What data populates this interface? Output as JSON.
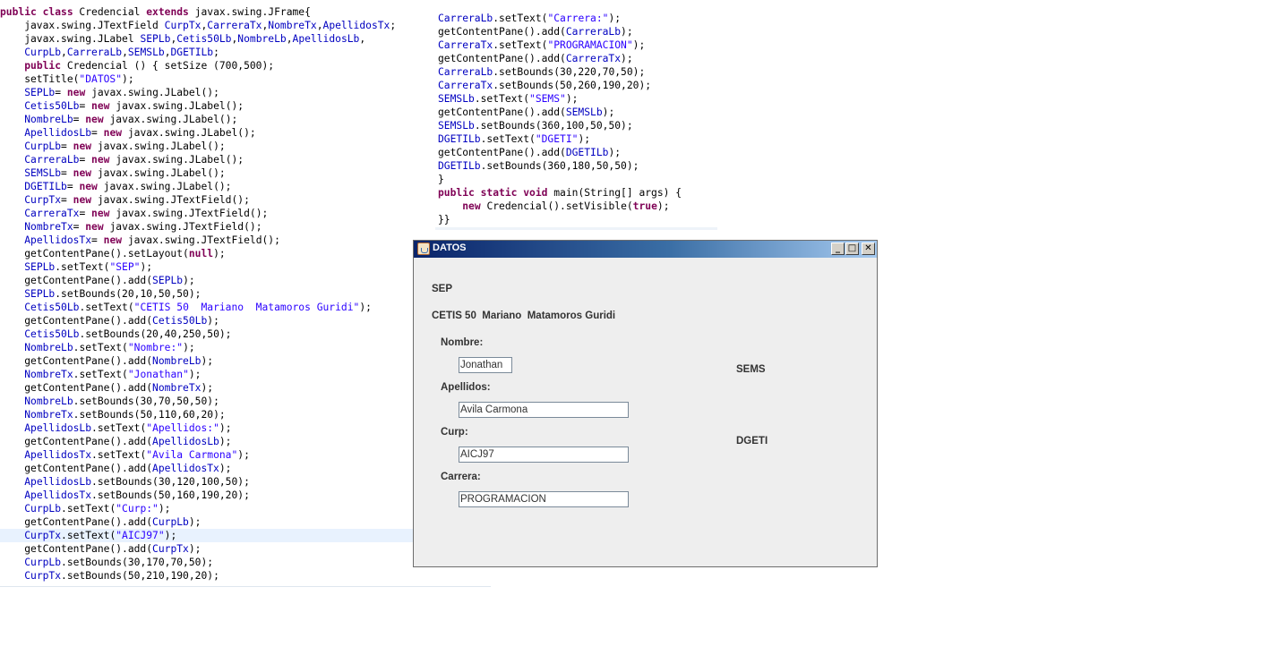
{
  "editor_left": {
    "lines": [
      [
        [
          "kw",
          "public class "
        ],
        [
          "",
          "Credencial "
        ],
        [
          "kw",
          "extends "
        ],
        [
          "",
          "javax.swing.JFrame{"
        ]
      ],
      [
        [
          "",
          "    javax.swing.JTextField "
        ],
        [
          "fld",
          "CurpTx"
        ],
        [
          "",
          ","
        ],
        [
          "fld",
          "CarreraTx"
        ],
        [
          "",
          ","
        ],
        [
          "fld",
          "NombreTx"
        ],
        [
          "",
          ","
        ],
        [
          "fld",
          "ApellidosTx"
        ],
        [
          "",
          ";"
        ]
      ],
      [
        [
          "",
          "    javax.swing.JLabel "
        ],
        [
          "fld",
          "SEPLb"
        ],
        [
          "",
          ","
        ],
        [
          "fld",
          "Cetis50Lb"
        ],
        [
          "",
          ","
        ],
        [
          "fld",
          "NombreLb"
        ],
        [
          "",
          ","
        ],
        [
          "fld",
          "ApellidosLb"
        ],
        [
          "",
          ","
        ]
      ],
      [
        [
          "",
          "    "
        ],
        [
          "fld",
          "CurpLb"
        ],
        [
          "",
          ","
        ],
        [
          "fld",
          "CarreraLb"
        ],
        [
          "",
          ","
        ],
        [
          "fld",
          "SEMSLb"
        ],
        [
          "",
          ","
        ],
        [
          "fld",
          "DGETILb"
        ],
        [
          "",
          ";"
        ]
      ],
      [
        [
          "",
          "    "
        ],
        [
          "kw",
          "public "
        ],
        [
          "",
          "Credencial () { setSize (700,500);"
        ]
      ],
      [
        [
          "",
          "    setTitle("
        ],
        [
          "str",
          "\"DATOS\""
        ],
        [
          "",
          ");"
        ]
      ],
      [
        [
          "",
          "    "
        ],
        [
          "fld",
          "SEPLb"
        ],
        [
          "",
          "= "
        ],
        [
          "kw",
          "new "
        ],
        [
          "",
          "javax.swing.JLabel();"
        ]
      ],
      [
        [
          "",
          "    "
        ],
        [
          "fld",
          "Cetis50Lb"
        ],
        [
          "",
          "= "
        ],
        [
          "kw",
          "new "
        ],
        [
          "",
          "javax.swing.JLabel();"
        ]
      ],
      [
        [
          "",
          "    "
        ],
        [
          "fld",
          "NombreLb"
        ],
        [
          "",
          "= "
        ],
        [
          "kw",
          "new "
        ],
        [
          "",
          "javax.swing.JLabel();"
        ]
      ],
      [
        [
          "",
          "    "
        ],
        [
          "fld",
          "ApellidosLb"
        ],
        [
          "",
          "= "
        ],
        [
          "kw",
          "new "
        ],
        [
          "",
          "javax.swing.JLabel();"
        ]
      ],
      [
        [
          "",
          "    "
        ],
        [
          "fld",
          "CurpLb"
        ],
        [
          "",
          "= "
        ],
        [
          "kw",
          "new "
        ],
        [
          "",
          "javax.swing.JLabel();"
        ]
      ],
      [
        [
          "",
          "    "
        ],
        [
          "fld",
          "CarreraLb"
        ],
        [
          "",
          "= "
        ],
        [
          "kw",
          "new "
        ],
        [
          "",
          "javax.swing.JLabel();"
        ]
      ],
      [
        [
          "",
          "    "
        ],
        [
          "fld",
          "SEMSLb"
        ],
        [
          "",
          "= "
        ],
        [
          "kw",
          "new "
        ],
        [
          "",
          "javax.swing.JLabel();"
        ]
      ],
      [
        [
          "",
          "    "
        ],
        [
          "fld",
          "DGETILb"
        ],
        [
          "",
          "= "
        ],
        [
          "kw",
          "new "
        ],
        [
          "",
          "javax.swing.JLabel();"
        ]
      ],
      [
        [
          "",
          "    "
        ],
        [
          "fld",
          "CurpTx"
        ],
        [
          "",
          "= "
        ],
        [
          "kw",
          "new "
        ],
        [
          "",
          "javax.swing.JTextField();"
        ]
      ],
      [
        [
          "",
          "    "
        ],
        [
          "fld",
          "CarreraTx"
        ],
        [
          "",
          "= "
        ],
        [
          "kw",
          "new "
        ],
        [
          "",
          "javax.swing.JTextField();"
        ]
      ],
      [
        [
          "",
          "    "
        ],
        [
          "fld",
          "NombreTx"
        ],
        [
          "",
          "= "
        ],
        [
          "kw",
          "new "
        ],
        [
          "",
          "javax.swing.JTextField();"
        ]
      ],
      [
        [
          "",
          "    "
        ],
        [
          "fld",
          "ApellidosTx"
        ],
        [
          "",
          "= "
        ],
        [
          "kw",
          "new "
        ],
        [
          "",
          "javax.swing.JTextField();"
        ]
      ],
      [
        [
          "",
          "    getContentPane().setLayout("
        ],
        [
          "kw",
          "null"
        ],
        [
          "",
          ");"
        ]
      ],
      [
        [
          "",
          "    "
        ],
        [
          "fld",
          "SEPLb"
        ],
        [
          "",
          ".setText("
        ],
        [
          "str",
          "\"SEP\""
        ],
        [
          "",
          ");"
        ]
      ],
      [
        [
          "",
          "    getContentPane().add("
        ],
        [
          "fld",
          "SEPLb"
        ],
        [
          "",
          ");"
        ]
      ],
      [
        [
          "",
          "    "
        ],
        [
          "fld",
          "SEPLb"
        ],
        [
          "",
          ".setBounds(20,10,50,50);"
        ]
      ],
      [
        [
          "",
          "    "
        ],
        [
          "fld",
          "Cetis50Lb"
        ],
        [
          "",
          ".setText("
        ],
        [
          "str",
          "\"CETIS 50  Mariano  Matamoros Guridi\""
        ],
        [
          "",
          ");"
        ]
      ],
      [
        [
          "",
          "    getContentPane().add("
        ],
        [
          "fld",
          "Cetis50Lb"
        ],
        [
          "",
          ");"
        ]
      ],
      [
        [
          "",
          "    "
        ],
        [
          "fld",
          "Cetis50Lb"
        ],
        [
          "",
          ".setBounds(20,40,250,50);"
        ]
      ],
      [
        [
          "",
          "    "
        ],
        [
          "fld",
          "NombreLb"
        ],
        [
          "",
          ".setText("
        ],
        [
          "str",
          "\"Nombre:\""
        ],
        [
          "",
          ");"
        ]
      ],
      [
        [
          "",
          "    getContentPane().add("
        ],
        [
          "fld",
          "NombreLb"
        ],
        [
          "",
          ");"
        ]
      ],
      [
        [
          "",
          "    "
        ],
        [
          "fld",
          "NombreTx"
        ],
        [
          "",
          ".setText("
        ],
        [
          "str",
          "\"Jonathan\""
        ],
        [
          "",
          ");"
        ]
      ],
      [
        [
          "",
          "    getContentPane().add("
        ],
        [
          "fld",
          "NombreTx"
        ],
        [
          "",
          ");"
        ]
      ],
      [
        [
          "",
          "    "
        ],
        [
          "fld",
          "NombreLb"
        ],
        [
          "",
          ".setBounds(30,70,50,50);"
        ]
      ],
      [
        [
          "",
          "    "
        ],
        [
          "fld",
          "NombreTx"
        ],
        [
          "",
          ".setBounds(50,110,60,20);"
        ]
      ],
      [
        [
          "",
          "    "
        ],
        [
          "fld",
          "ApellidosLb"
        ],
        [
          "",
          ".setText("
        ],
        [
          "str",
          "\"Apellidos:\""
        ],
        [
          "",
          ");"
        ]
      ],
      [
        [
          "",
          "    getContentPane().add("
        ],
        [
          "fld",
          "ApellidosLb"
        ],
        [
          "",
          ");"
        ]
      ],
      [
        [
          "",
          "    "
        ],
        [
          "fld",
          "ApellidosTx"
        ],
        [
          "",
          ".setText("
        ],
        [
          "str",
          "\"Avila Carmona\""
        ],
        [
          "",
          ");"
        ]
      ],
      [
        [
          "",
          "    getContentPane().add("
        ],
        [
          "fld",
          "ApellidosTx"
        ],
        [
          "",
          ");"
        ]
      ],
      [
        [
          "",
          "    "
        ],
        [
          "fld",
          "ApellidosLb"
        ],
        [
          "",
          ".setBounds(30,120,100,50);"
        ]
      ],
      [
        [
          "",
          "    "
        ],
        [
          "fld",
          "ApellidosTx"
        ],
        [
          "",
          ".setBounds(50,160,190,20);"
        ]
      ],
      [
        [
          "",
          "    "
        ],
        [
          "fld",
          "CurpLb"
        ],
        [
          "",
          ".setText("
        ],
        [
          "str",
          "\"Curp:\""
        ],
        [
          "",
          ");"
        ]
      ],
      [
        [
          "",
          "    getContentPane().add("
        ],
        [
          "fld",
          "CurpLb"
        ],
        [
          "",
          ");"
        ]
      ],
      [
        [
          "",
          "    "
        ],
        [
          "fld",
          "CurpTx"
        ],
        [
          "",
          ".setText("
        ],
        [
          "str",
          "\"AICJ97\""
        ],
        [
          "",
          ");"
        ]
      ],
      [
        [
          "",
          "    getContentPane().add("
        ],
        [
          "fld",
          "CurpTx"
        ],
        [
          "",
          ");"
        ]
      ],
      [
        [
          "",
          "    "
        ],
        [
          "fld",
          "CurpLb"
        ],
        [
          "",
          ".setBounds(30,170,70,50);"
        ]
      ],
      [
        [
          "",
          "    "
        ],
        [
          "fld",
          "CurpTx"
        ],
        [
          "",
          ".setBounds(50,210,190,20);"
        ]
      ]
    ],
    "highlight_line": 39
  },
  "editor_right": {
    "lines": [
      [
        [
          "fld",
          "CarreraLb"
        ],
        [
          "",
          ".setText("
        ],
        [
          "str",
          "\"Carrera:\""
        ],
        [
          "",
          ");"
        ]
      ],
      [
        [
          "",
          "getContentPane().add("
        ],
        [
          "fld",
          "CarreraLb"
        ],
        [
          "",
          ");"
        ]
      ],
      [
        [
          "fld",
          "CarreraTx"
        ],
        [
          "",
          ".setText("
        ],
        [
          "str",
          "\"PROGRAMACION\""
        ],
        [
          "",
          ");"
        ]
      ],
      [
        [
          "",
          "getContentPane().add("
        ],
        [
          "fld",
          "CarreraTx"
        ],
        [
          "",
          ");"
        ]
      ],
      [
        [
          "fld",
          "CarreraLb"
        ],
        [
          "",
          ".setBounds(30,220,70,50);"
        ]
      ],
      [
        [
          "fld",
          "CarreraTx"
        ],
        [
          "",
          ".setBounds(50,260,190,20);"
        ]
      ],
      [
        [
          "fld",
          "SEMSLb"
        ],
        [
          "",
          ".setText("
        ],
        [
          "str",
          "\"SEMS\""
        ],
        [
          "",
          ");"
        ]
      ],
      [
        [
          "",
          "getContentPane().add("
        ],
        [
          "fld",
          "SEMSLb"
        ],
        [
          "",
          ");"
        ]
      ],
      [
        [
          "fld",
          "SEMSLb"
        ],
        [
          "",
          ".setBounds(360,100,50,50);"
        ]
      ],
      [
        [
          "fld",
          "DGETILb"
        ],
        [
          "",
          ".setText("
        ],
        [
          "str",
          "\"DGETI\""
        ],
        [
          "",
          ");"
        ]
      ],
      [
        [
          "",
          "getContentPane().add("
        ],
        [
          "fld",
          "DGETILb"
        ],
        [
          "",
          ");"
        ]
      ],
      [
        [
          "fld",
          "DGETILb"
        ],
        [
          "",
          ".setBounds(360,180,50,50);"
        ]
      ],
      [
        [
          "",
          "}"
        ]
      ],
      [
        [
          "kw",
          "public static void "
        ],
        [
          "",
          "main(String[] args) {"
        ]
      ],
      [
        [
          "",
          "    "
        ],
        [
          "kw",
          "new "
        ],
        [
          "",
          "Credencial().setVisible("
        ],
        [
          "kw",
          "true"
        ],
        [
          "",
          ");"
        ]
      ],
      [
        [
          "",
          "}}"
        ]
      ]
    ]
  },
  "window": {
    "title": "DATOS",
    "controls": {
      "minimize": "_",
      "maximize": "□",
      "close": "✕"
    },
    "labels": {
      "sep": "SEP",
      "cetis": "CETIS 50  Mariano  Matamoros Guridi",
      "nombre": "Nombre:",
      "apellidos": "Apellidos:",
      "curp": "Curp:",
      "carrera": "Carrera:",
      "sems": "SEMS",
      "dgeti": "DGETI"
    },
    "fields": {
      "nombre": "Jonathan",
      "apellidos": "Avila Carmona",
      "curp": "AICJ97",
      "carrera": "PROGRAMACION"
    }
  },
  "colors": {
    "keyword": "#7f0055",
    "field": "#0000c0",
    "string": "#2a00ff",
    "titlebar_start": "#0a246a",
    "titlebar_end": "#a6caf0"
  }
}
